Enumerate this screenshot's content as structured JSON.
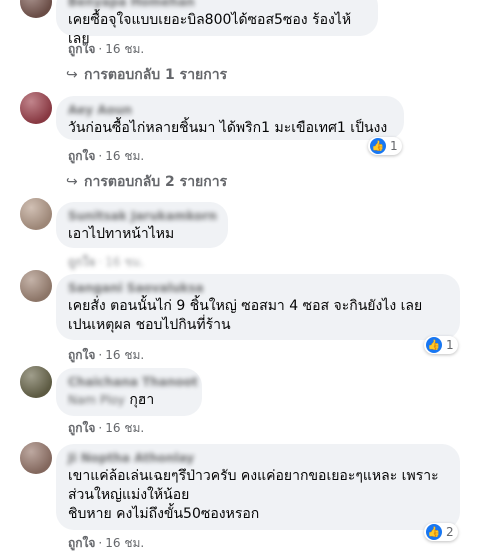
{
  "comments": [
    {
      "author": "Benyapa Homehan",
      "text": "เคยซื้อจุใจแบบเยอะบิล800ได้ซอส5ซอง ร้องไห้เลย",
      "like": "ถูกใจ",
      "time": "16 ชม.",
      "replies": "การตอบกลับ 1 รายการ"
    },
    {
      "author": "Aey Aoun",
      "text": "วันก่อนซื้อไก่หลายชิ้นมา ได้พริก1 มะเขือเทศ1 เป็นงง",
      "like": "ถูกใจ",
      "time": "16 ชม.",
      "reactions": "1",
      "replies": "การตอบกลับ 2 รายการ"
    },
    {
      "author": "Sunitsak Jarukamkorn",
      "text": "เอาไปทาหน้าไหม",
      "like": "ถูกใจ",
      "time": "16 ชม."
    },
    {
      "author": "Sangani Saovaluksa",
      "text": "เคยสั่ง ตอนนั้นไก่ 9 ชิ้นใหญ่ ซอสมา 4 ซอส จะกินยังไง เลย\nเปนเหตุผล ชอบไปกินที่ร้าน",
      "like": "ถูกใจ",
      "time": "16 ชม.",
      "reactions": "1"
    },
    {
      "author": "Chaichana Thanoot",
      "tag": "Nam Ploy",
      "text": "กุฮา",
      "like": "ถูกใจ",
      "time": "16 ชม."
    },
    {
      "author": "Ji Noptha Athonlay",
      "text": "เขาแค่ล้อเล่นเฉยๆรึป่าวครับ คงแค่อยากขอเยอะๆแหละ เพราะ\nส่วนใหญ่แม่งให้น้อย\nชิบหาย คงไม่ถึงขั้น50ซองหรอก",
      "like": "ถูกใจ",
      "time": "16 ชม.",
      "reactions": "2"
    }
  ],
  "icons": {
    "reply": "reply-arrow-icon",
    "like_badge": "like-thumb-icon"
  },
  "colors": {
    "bubble": "#f0f2f5",
    "meta": "#65676b",
    "like": "#1877f2"
  }
}
